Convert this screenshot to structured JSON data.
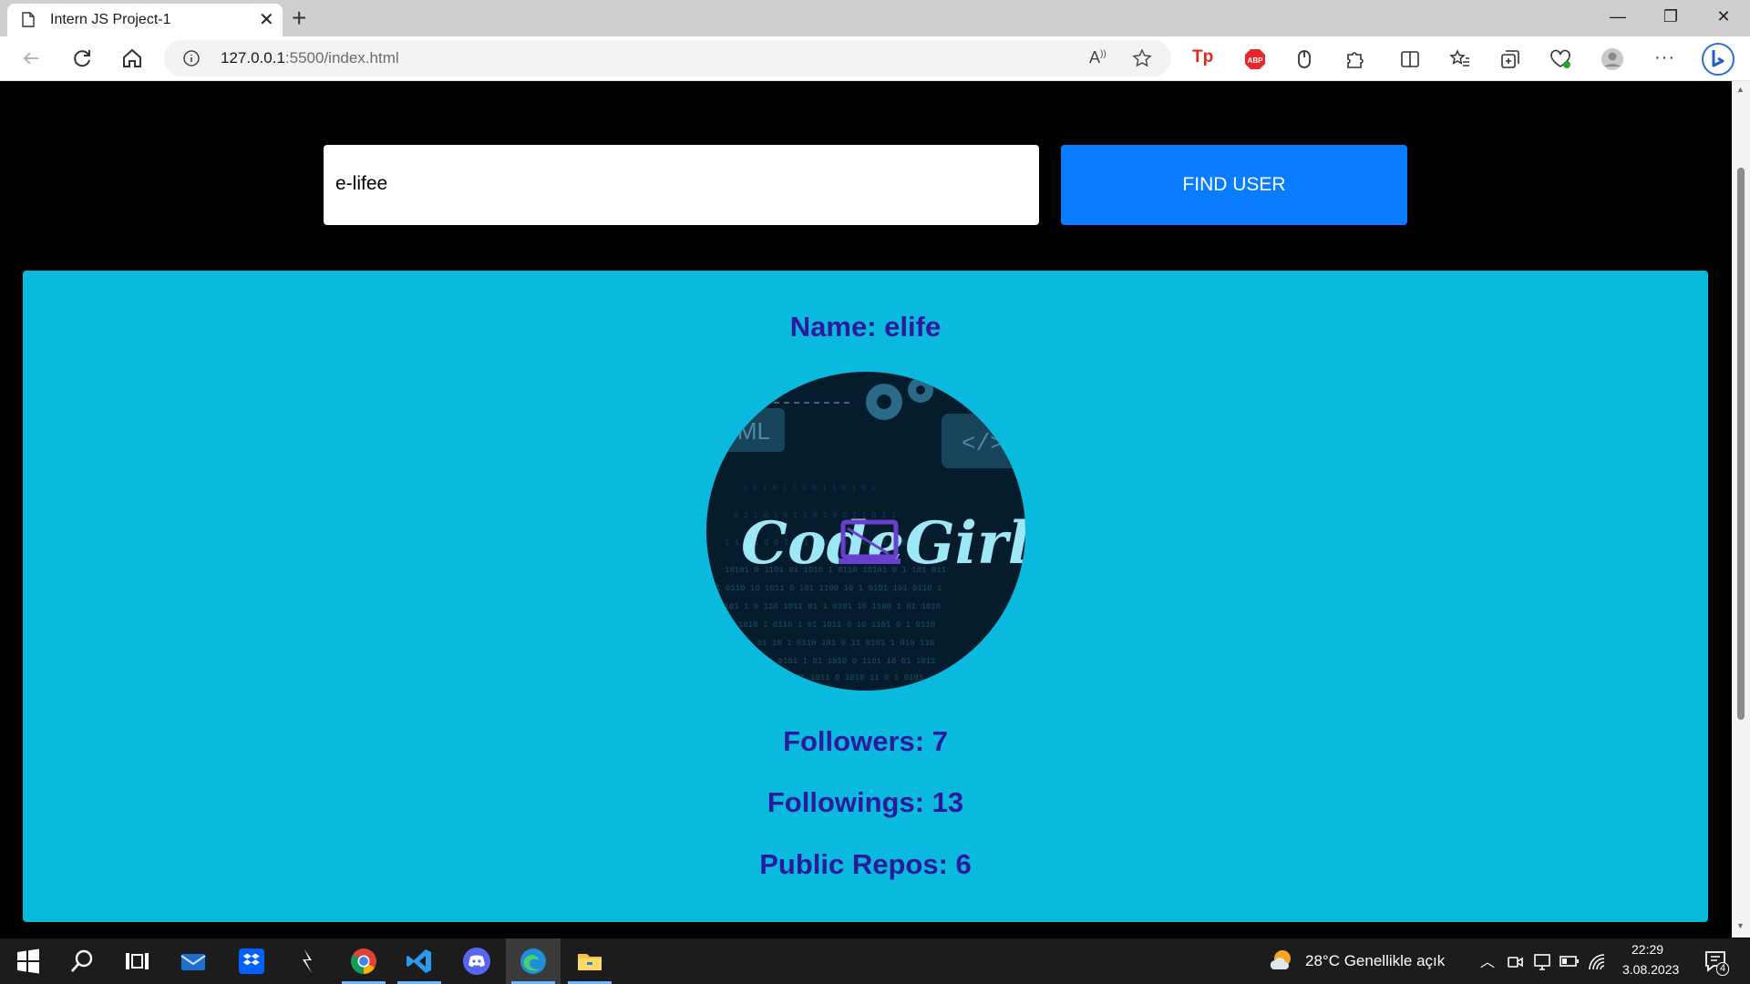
{
  "browser": {
    "tab_title": "Intern JS Project-1",
    "url_host": "127.0.0.1",
    "url_path": ":5500/index.html"
  },
  "search": {
    "value": "e-lifee",
    "button_label": "FIND USER"
  },
  "profile": {
    "name_line": "Name: elife",
    "avatar_text_left": "Code",
    "avatar_text_right": "Girl",
    "avatar_badge_html": "TML",
    "avatar_badge_code": "</>",
    "followers_line": "Followers: 7",
    "followings_line": "Followings: 13",
    "repos_line": "Public Repos: 6"
  },
  "taskbar": {
    "weather": "28°C  Genellikle açık",
    "time": "22:29",
    "date": "3.08.2023",
    "notification_count": "4"
  },
  "colors": {
    "accent_button": "#0a7cff",
    "card_bg": "#0ab9de",
    "profile_text": "#2c1a9c"
  }
}
